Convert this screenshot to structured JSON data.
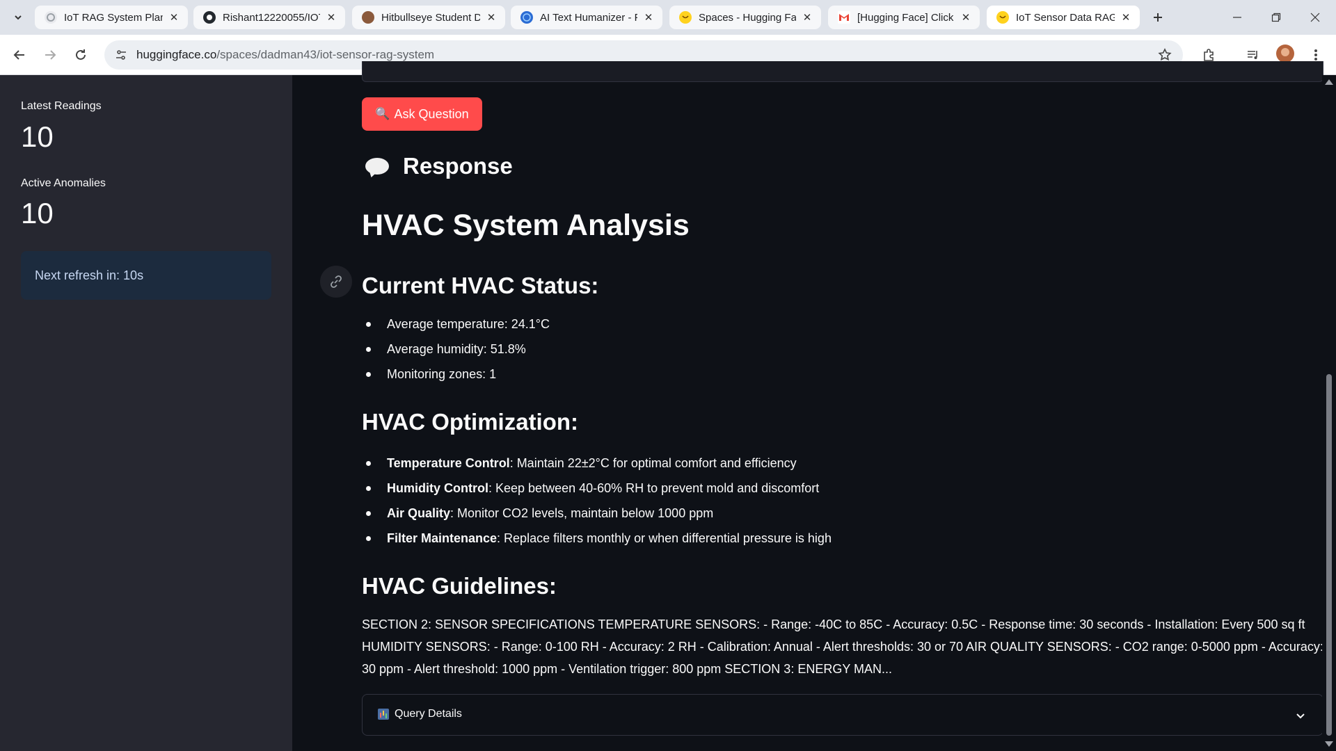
{
  "browser": {
    "tabs": [
      {
        "title": "IoT RAG System Plan",
        "icon": "sparkle-icon",
        "active": false
      },
      {
        "title": "Rishant12220055/IOT",
        "icon": "github-icon",
        "active": false
      },
      {
        "title": "Hitbullseye Student D",
        "icon": "student-icon",
        "active": false
      },
      {
        "title": "AI Text Humanizer - F",
        "icon": "globe-icon",
        "active": false
      },
      {
        "title": "Spaces - Hugging Fa",
        "icon": "hugging-face-icon",
        "active": false
      },
      {
        "title": "[Hugging Face] Click",
        "icon": "gmail-icon",
        "active": false
      },
      {
        "title": "IoT Sensor Data RAG",
        "icon": "hugging-face-icon",
        "active": true
      }
    ],
    "url_host": "huggingface.co",
    "url_path": "/spaces/dadman43/iot-sensor-rag-system"
  },
  "sidebar": {
    "metrics": [
      {
        "label": "Latest Readings",
        "value": "10"
      },
      {
        "label": "Active Anomalies",
        "value": "10"
      }
    ],
    "refresh_text": "Next refresh in: 10s"
  },
  "main": {
    "ask_button": "Ask Question",
    "response_header": "Response",
    "title": "HVAC System Analysis",
    "status": {
      "heading": "Current HVAC Status:",
      "items": [
        "Average temperature: 24.1°C",
        "Average humidity: 51.8%",
        "Monitoring zones: 1"
      ]
    },
    "optimization": {
      "heading": "HVAC Optimization:",
      "items": [
        {
          "label": "Temperature Control",
          "text": ": Maintain 22±2°C for optimal comfort and efficiency"
        },
        {
          "label": "Humidity Control",
          "text": ": Keep between 40-60% RH to prevent mold and discomfort"
        },
        {
          "label": "Air Quality",
          "text": ": Monitor CO2 levels, maintain below 1000 ppm"
        },
        {
          "label": "Filter Maintenance",
          "text": ": Replace filters monthly or when differential pressure is high"
        }
      ]
    },
    "guidelines": {
      "heading": "HVAC Guidelines:",
      "text": "SECTION 2: SENSOR SPECIFICATIONS TEMPERATURE SENSORS: - Range: -40C to 85C - Accuracy: 0.5C - Response time: 30 seconds - Installation: Every 500 sq ft HUMIDITY SENSORS: - Range: 0-100 RH - Accuracy: 2 RH - Calibration: Annual - Alert thresholds: 30 or 70 AIR QUALITY SENSORS: - CO2 range: 0-5000 ppm - Accuracy: 30 ppm - Alert threshold: 1000 ppm - Ventilation trigger: 800 ppm SECTION 3: ENERGY MAN..."
    },
    "query_details": "Query Details"
  },
  "colors": {
    "app_bg": "#0e1117",
    "sidebar_bg": "#262730",
    "accent_button": "#ff4b4b",
    "info_box": "#1c2b3e"
  }
}
